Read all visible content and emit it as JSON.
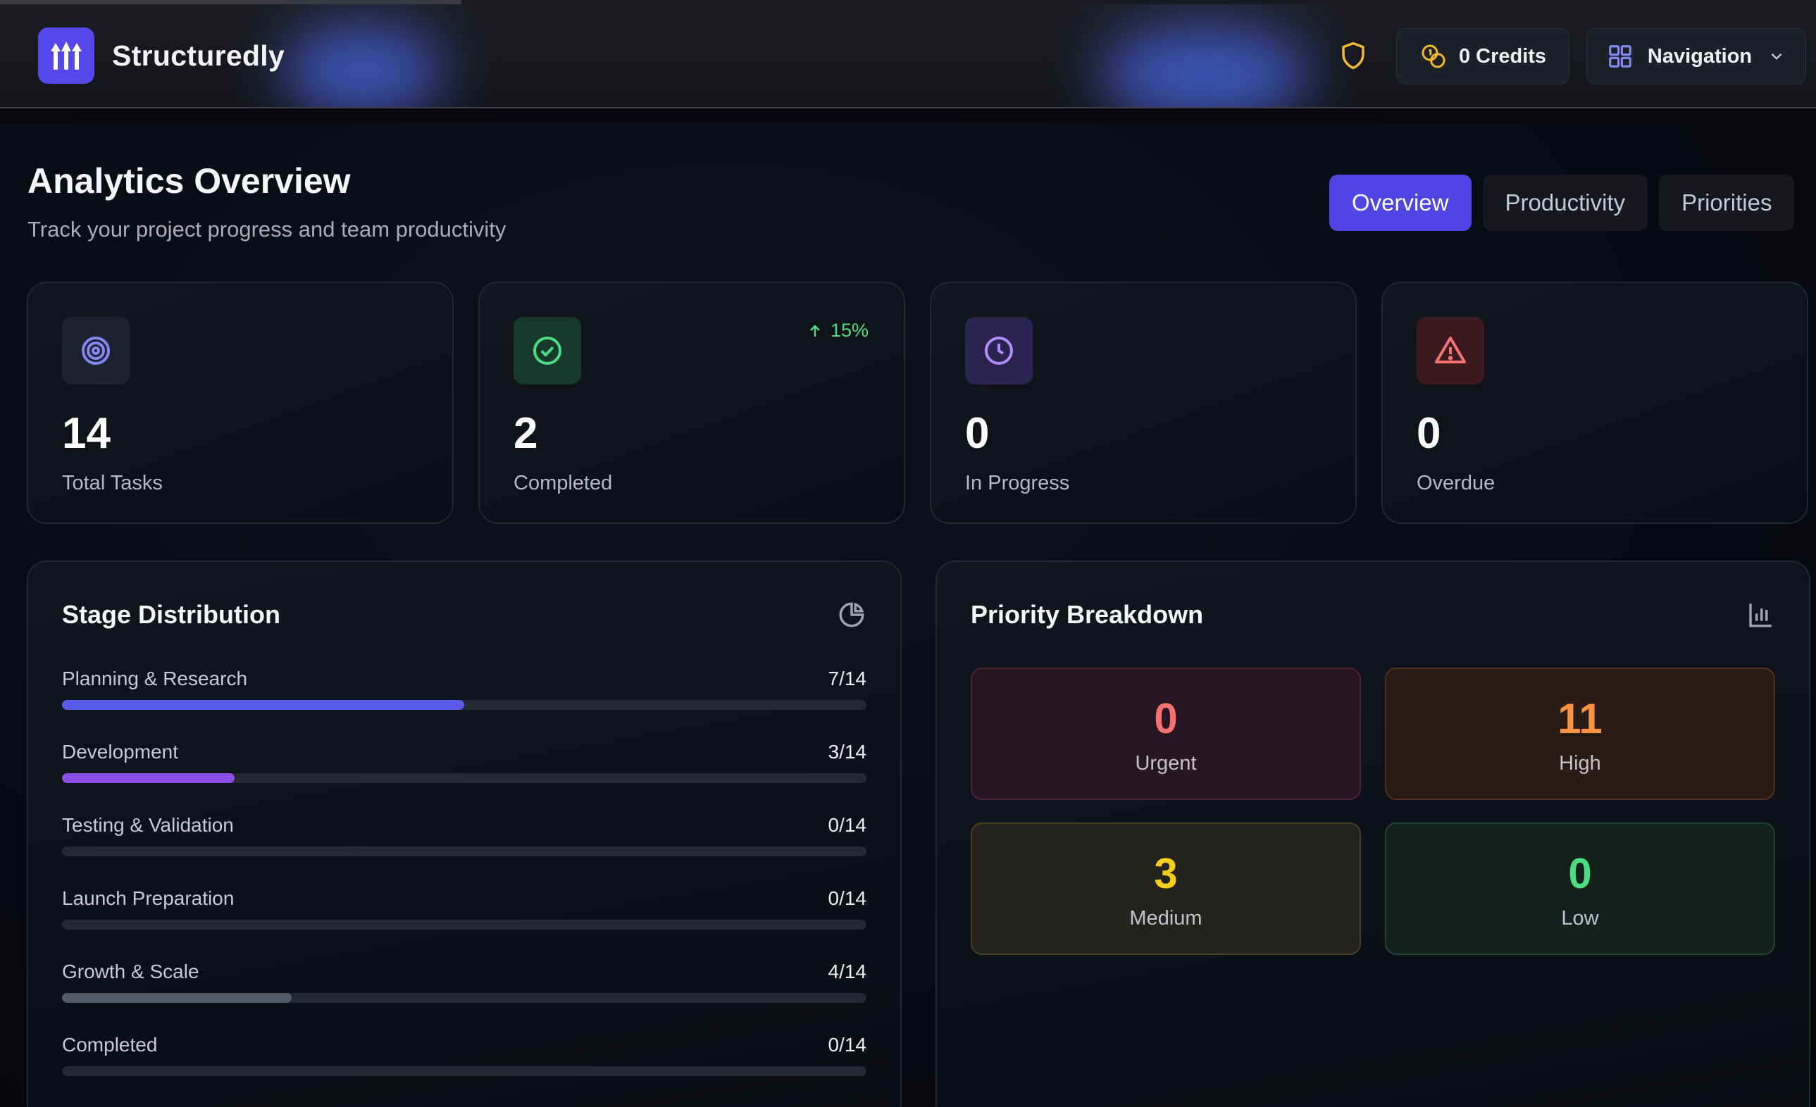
{
  "app": {
    "name": "Structuredly"
  },
  "header": {
    "credits_label": "0 Credits",
    "nav_label": "Navigation"
  },
  "page": {
    "title": "Analytics Overview",
    "subtitle": "Track your project progress and team productivity",
    "tabs": [
      {
        "label": "Overview",
        "active": true
      },
      {
        "label": "Productivity",
        "active": false
      },
      {
        "label": "Priorities",
        "active": false
      }
    ]
  },
  "stats": [
    {
      "value": "14",
      "label": "Total Tasks",
      "icon": "target-icon",
      "color": "#7c83f6"
    },
    {
      "value": "2",
      "label": "Completed",
      "icon": "check-circle-icon",
      "color": "#4ade80",
      "trend": "15%"
    },
    {
      "value": "0",
      "label": "In Progress",
      "icon": "clock-icon",
      "color": "#a78bfa"
    },
    {
      "value": "0",
      "label": "Overdue",
      "icon": "alert-triangle-icon",
      "color": "#f87171"
    }
  ],
  "stage_distribution": {
    "title": "Stage Distribution",
    "icon": "pie-chart-icon",
    "stages": [
      {
        "name": "Planning & Research",
        "count": "7/14",
        "fraction": 0.5,
        "color": "#5b5bea"
      },
      {
        "name": "Development",
        "count": "3/14",
        "fraction": 0.2143,
        "color": "#8b4fe8"
      },
      {
        "name": "Testing & Validation",
        "count": "0/14",
        "fraction": 0,
        "color": "#5b5bea"
      },
      {
        "name": "Launch Preparation",
        "count": "0/14",
        "fraction": 0,
        "color": "#5b5bea"
      },
      {
        "name": "Growth & Scale",
        "count": "4/14",
        "fraction": 0.2857,
        "color": "#555b6a"
      },
      {
        "name": "Completed",
        "count": "0/14",
        "fraction": 0,
        "color": "#5b5bea"
      }
    ]
  },
  "priority_breakdown": {
    "title": "Priority Breakdown",
    "icon": "bar-chart-icon",
    "items": [
      {
        "value": "0",
        "label": "Urgent",
        "color": "#f87171"
      },
      {
        "value": "11",
        "label": "High",
        "color": "#fb923c"
      },
      {
        "value": "3",
        "label": "Medium",
        "color": "#facc15"
      },
      {
        "value": "0",
        "label": "Low",
        "color": "#4ade80"
      }
    ]
  }
}
